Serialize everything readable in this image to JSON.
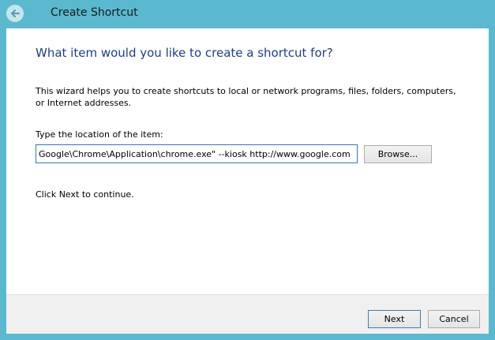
{
  "window": {
    "title": "Create Shortcut"
  },
  "wizard": {
    "heading": "What item would you like to create a shortcut for?",
    "description": "This wizard helps you to create shortcuts to local or network programs, files, folders, computers, or Internet addresses.",
    "location_label": "Type the location of the item:",
    "location_value": "Google\\Chrome\\Application\\chrome.exe\" --kiosk http://www.google.com",
    "browse_label": "Browse...",
    "continue_text": "Click Next to continue."
  },
  "footer": {
    "next_label": "Next",
    "cancel_label": "Cancel"
  },
  "colors": {
    "frame": "#5ab9cf",
    "heading": "#1e3d8f",
    "input_border": "#2f78c5"
  },
  "icons": {
    "back": "back-arrow-icon"
  }
}
